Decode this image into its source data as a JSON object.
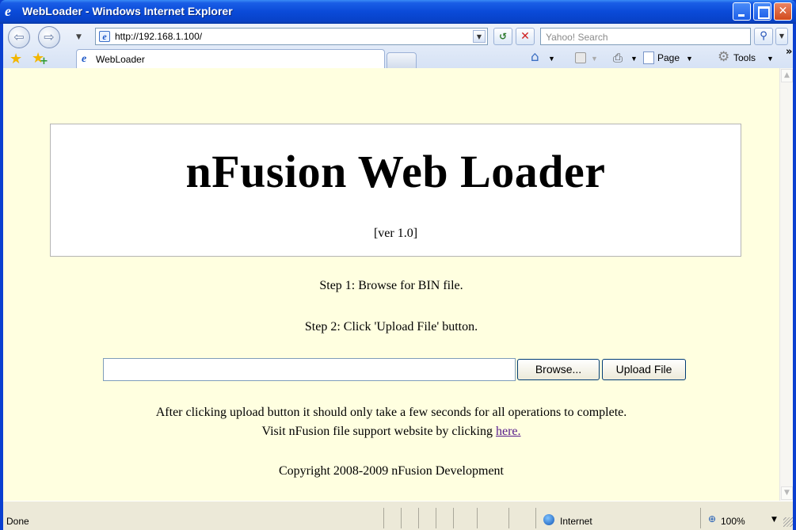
{
  "window": {
    "title": "WebLoader - Windows Internet Explorer"
  },
  "toolbar": {
    "address": "http://192.168.1.100/",
    "search_placeholder": "Yahoo! Search"
  },
  "tabs": [
    {
      "label": "WebLoader"
    }
  ],
  "commands": {
    "page": "Page",
    "tools": "Tools"
  },
  "page": {
    "heading": "nFusion Web Loader",
    "version": "[ver 1.0]",
    "step1": "Step 1: Browse for BIN file.",
    "step2": "Step 2: Click 'Upload File' button.",
    "browse_label": "Browse...",
    "upload_label": "Upload File",
    "note_line1": "After clicking upload button it should only take a few seconds for all operations to complete.",
    "note_line2_prefix": "Visit nFusion file support website by clicking",
    "note_link": "here.",
    "copyright": "Copyright 2008-2009 nFusion Development"
  },
  "statusbar": {
    "status": "Done",
    "zone": "Internet",
    "zoom": "100%"
  },
  "colors": {
    "page_background": "#ffffe0",
    "titlebar": "#0a4ad8",
    "link_visited": "#551a8b"
  }
}
